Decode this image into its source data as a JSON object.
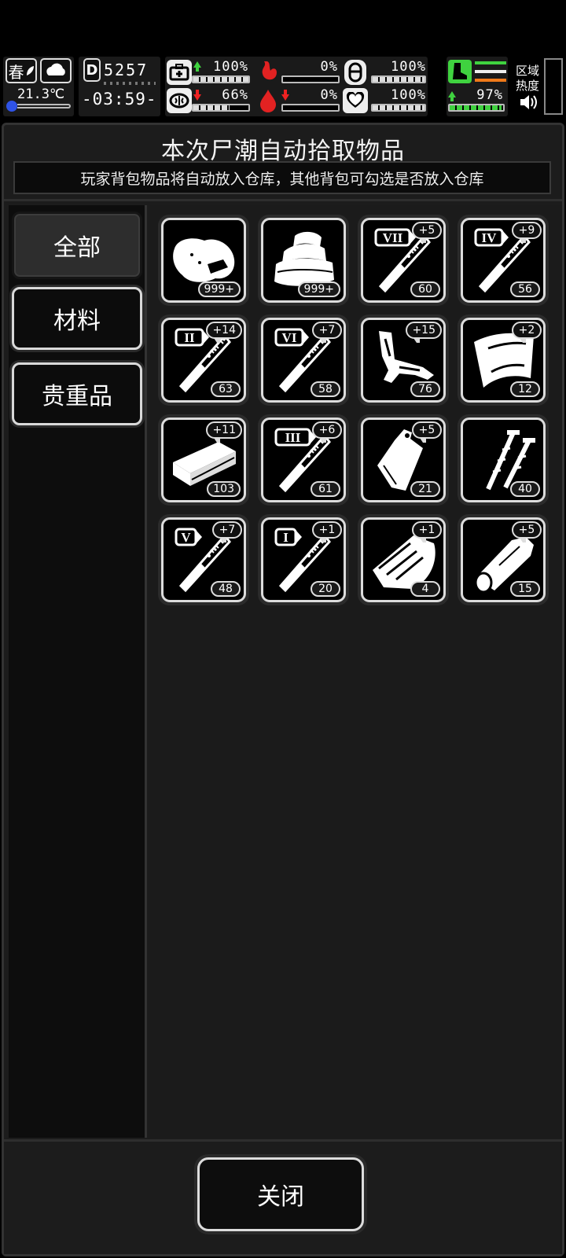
{
  "status": {
    "season": "春",
    "temperature": "21.3℃",
    "day_counter": "5257",
    "clock": "-03:59-",
    "health_pct": "100%",
    "stomach_pct": "0%",
    "stamina_pct": "100%",
    "sanity_pct": "66%",
    "thirst_pct": "0%",
    "mood_pct": "100%",
    "leg_pct": "97%",
    "zone_label_1": "区域",
    "zone_label_2": "热度",
    "bars": {
      "health": 1.0,
      "stomach": 0.0,
      "stamina": 1.0,
      "sanity": 0.66,
      "thirst": 0.0,
      "mood": 1.0,
      "leg": 0.97
    },
    "colors": {
      "up": "#3fd23f",
      "down": "#e22222",
      "stomach": "#e22222"
    }
  },
  "panel": {
    "title": "本次尸潮自动拾取物品",
    "subtitle": "玩家背包物品将自动放入仓库，其他背包可勾选是否放入仓库"
  },
  "tabs": [
    {
      "label": "全部",
      "active": true
    },
    {
      "label": "材料",
      "active": false
    },
    {
      "label": "贵重品",
      "active": false
    }
  ],
  "items": [
    {
      "icon": "meat-chunk-icon",
      "qty": "999+",
      "bonus": ""
    },
    {
      "icon": "cloth-stack-icon",
      "qty": "999+",
      "bonus": ""
    },
    {
      "icon": "syringe-VII-icon",
      "roman": "VII",
      "qty": "60",
      "bonus": "+5"
    },
    {
      "icon": "syringe-IV-icon",
      "roman": "IV",
      "qty": "56",
      "bonus": "+9"
    },
    {
      "icon": "syringe-II-icon",
      "roman": "II",
      "qty": "63",
      "bonus": "+14"
    },
    {
      "icon": "syringe-VI-icon",
      "roman": "VI",
      "qty": "58",
      "bonus": "+7"
    },
    {
      "icon": "wire-scrap-icon",
      "qty": "76",
      "bonus": "+15"
    },
    {
      "icon": "leather-sheet-icon",
      "qty": "12",
      "bonus": "+2"
    },
    {
      "icon": "wood-plank-icon",
      "qty": "103",
      "bonus": "+11"
    },
    {
      "icon": "syringe-III-icon",
      "roman": "III",
      "qty": "61",
      "bonus": "+6"
    },
    {
      "icon": "plastic-bag-icon",
      "qty": "21",
      "bonus": "+5"
    },
    {
      "icon": "screws-icon",
      "qty": "40",
      "bonus": ""
    },
    {
      "icon": "syringe-V-icon",
      "roman": "V",
      "qty": "48",
      "bonus": "+7"
    },
    {
      "icon": "syringe-I-icon",
      "roman": "I",
      "qty": "20",
      "bonus": "+1"
    },
    {
      "icon": "bark-plank-icon",
      "qty": "4",
      "bonus": "+1"
    },
    {
      "icon": "log-icon",
      "qty": "15",
      "bonus": "+5"
    }
  ],
  "close_label": "关闭"
}
